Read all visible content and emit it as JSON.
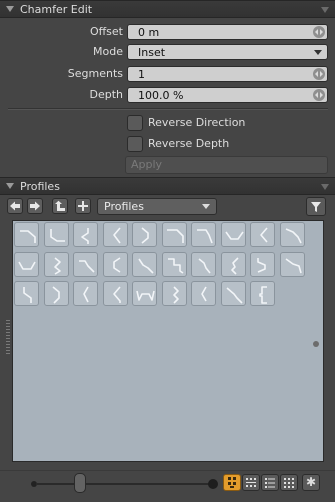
{
  "chamfer": {
    "title": "Chamfer Edit",
    "offset_label": "Offset",
    "offset_value": "0 m",
    "mode_label": "Mode",
    "mode_value": "Inset",
    "segments_label": "Segments",
    "segments_value": "1",
    "depth_label": "Depth",
    "depth_value": "100.0 %",
    "reverse_direction_label": "Reverse Direction",
    "reverse_depth_label": "Reverse Depth",
    "apply_label": "Apply"
  },
  "profiles": {
    "title": "Profiles",
    "preset_value": "Profiles",
    "toolbar_icons": [
      "arrow-left-icon",
      "arrow-right-icon",
      "up-folder-icon",
      "plus-icon",
      "filter-icon"
    ],
    "tile_count": 29
  },
  "footer": {
    "view_buttons": [
      "large-thumbnail-view-icon",
      "small-thumbnail-view-icon",
      "list-view-icon",
      "grid-view-icon"
    ],
    "settings_icon": "gear-icon"
  },
  "colors": {
    "accent": "#e39c2c",
    "panel_bg": "#454545",
    "grid_bg": "#a8b2bb"
  }
}
